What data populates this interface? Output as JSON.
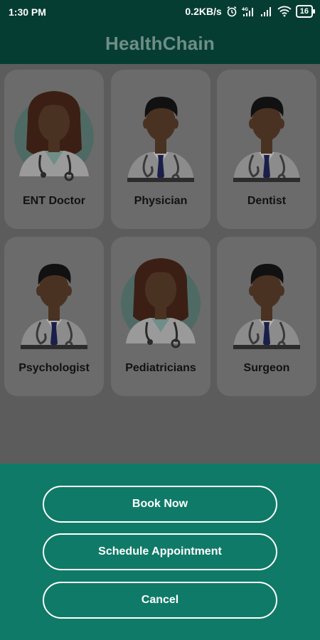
{
  "status_bar": {
    "time": "1:30 PM",
    "network_speed": "0.2KB/s",
    "battery": "16",
    "icons": [
      "alarm-icon",
      "signal-4g-icon",
      "signal-icon",
      "wifi-icon",
      "battery-icon"
    ]
  },
  "app_bar": {
    "title": "HealthChain"
  },
  "specialties": [
    {
      "label": "ENT Doctor",
      "avatar": "female-doctor-avatar"
    },
    {
      "label": "Physician",
      "avatar": "male-doctor-avatar"
    },
    {
      "label": "Dentist",
      "avatar": "male-doctor-avatar"
    },
    {
      "label": "Psychologist",
      "avatar": "male-doctor-avatar"
    },
    {
      "label": "Pediatricians",
      "avatar": "female-doctor-avatar"
    },
    {
      "label": "Surgeon",
      "avatar": "male-doctor-avatar"
    }
  ],
  "actions": {
    "book_now": "Book Now",
    "schedule": "Schedule Appointment",
    "cancel": "Cancel"
  },
  "colors": {
    "header": "#063d33",
    "sheet": "#0f7a67",
    "overlay": "#5c5c5c",
    "card": "#6b6b6b"
  }
}
